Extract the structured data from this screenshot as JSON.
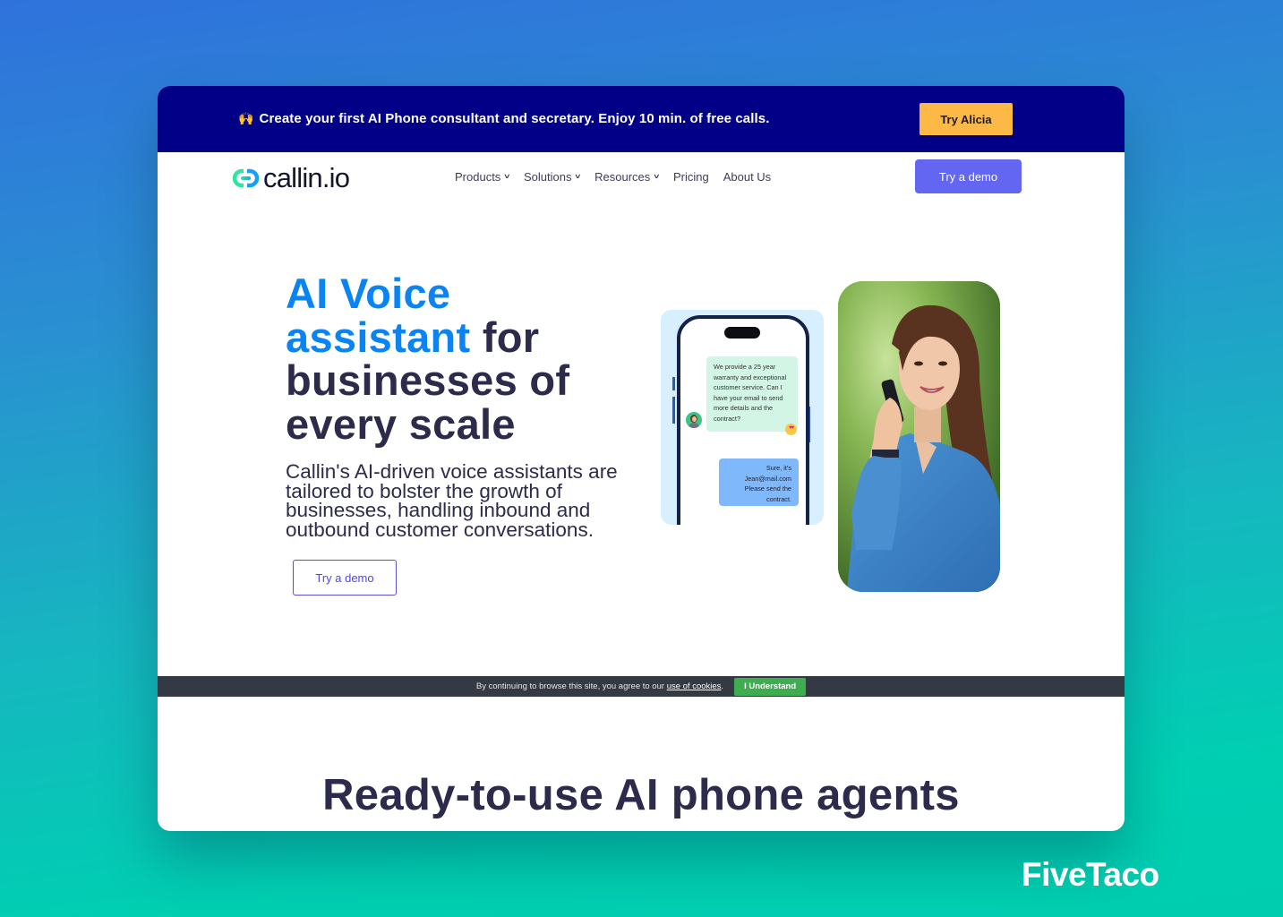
{
  "promo": {
    "emoji": "🙌",
    "text": "Create your first AI Phone consultant and secretary. Enjoy 10 min. of free calls.",
    "button_label": "Try Alicia"
  },
  "nav": {
    "logo_text": "callin.io",
    "items": [
      {
        "label": "Products",
        "has_dropdown": true
      },
      {
        "label": "Solutions",
        "has_dropdown": true
      },
      {
        "label": "Resources",
        "has_dropdown": true
      },
      {
        "label": "Pricing",
        "has_dropdown": false
      },
      {
        "label": "About Us",
        "has_dropdown": false
      }
    ],
    "chevron": "⌄",
    "cta_label": "Try a demo"
  },
  "hero": {
    "title_accent_1": "AI Voice",
    "title_accent_2": "assistant",
    "title_rest_1": " for",
    "title_rest_2": "businesses of",
    "title_rest_3": "every scale",
    "subtitle": "Callin's AI-driven voice assistants are tailored to bolster the growth of businesses, handling inbound and outbound customer conversations.",
    "cta_label": "Try a demo"
  },
  "chat": {
    "incoming": "We  provide a 25 year warranty and exceptional customer service. Can I have your email to send more details and the contract?",
    "outgoing_lines": [
      "Sure, it's",
      "Jean@mail.com",
      "Please send the",
      "contract."
    ],
    "reaction": "♥♥"
  },
  "cookie": {
    "text": "By continuing to browse this site, you agree to our",
    "link": "use of cookies",
    "period": ".",
    "button_label": "I Understand"
  },
  "section": {
    "title": "Ready-to-use AI phone agents"
  },
  "watermark": "FiveTaco",
  "colors": {
    "promo_bg": "#020087",
    "accent_yellow": "#fdb945",
    "accent_indigo": "#6366f1",
    "headline_blue": "#0b84f3",
    "text_dark": "#2c2b4b",
    "cookie_bg": "#333a44",
    "cookie_button": "#3fac4f"
  }
}
